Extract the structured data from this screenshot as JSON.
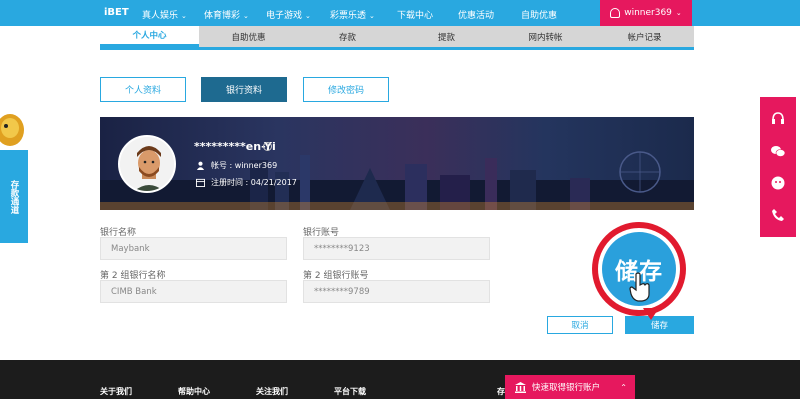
{
  "topnav": {
    "brand": "iBET",
    "items": [
      {
        "label": "真人娱乐"
      },
      {
        "label": "体育博彩"
      },
      {
        "label": "电子游戏"
      },
      {
        "label": "彩票乐透"
      },
      {
        "label": "下载中心"
      },
      {
        "label": "优惠活动"
      },
      {
        "label": "自助优惠"
      }
    ],
    "user": "winner369"
  },
  "subnav": {
    "tabs": [
      "个人中心",
      "自助优惠",
      "存款",
      "提款",
      "网内转帐",
      "帐户记录"
    ],
    "active": 0
  },
  "subtabs": [
    "个人资料",
    "银行资料",
    "修改密码"
  ],
  "banner": {
    "name": "*********en-Yi",
    "account": "帐号 : winner369",
    "registered": "注册时间 : 04/21/2017"
  },
  "form": {
    "bank_name_label": "银行名称",
    "bank_name_value": "Maybank",
    "bank_account_label": "银行账号",
    "bank_account_value": "********9123",
    "bank2_name_label": "第 2 组银行名称",
    "bank2_name_value": "CIMB Bank",
    "bank2_account_label": "第 2 组银行账号",
    "bank2_account_value": "********9789"
  },
  "buttons": {
    "cancel": "取消",
    "save": "储存"
  },
  "callout": {
    "text": "储存"
  },
  "left_float": "存款通道",
  "footer": {
    "links": [
      "关于我们",
      "帮助中心",
      "关注我们",
      "平台下载",
      "存"
    ],
    "quick_bar": "快速取得银行账户"
  },
  "colors": {
    "primary": "#29a8e0",
    "accent": "#e6185e",
    "dark_button": "#1e6a90",
    "footer": "#1c1c1c"
  }
}
